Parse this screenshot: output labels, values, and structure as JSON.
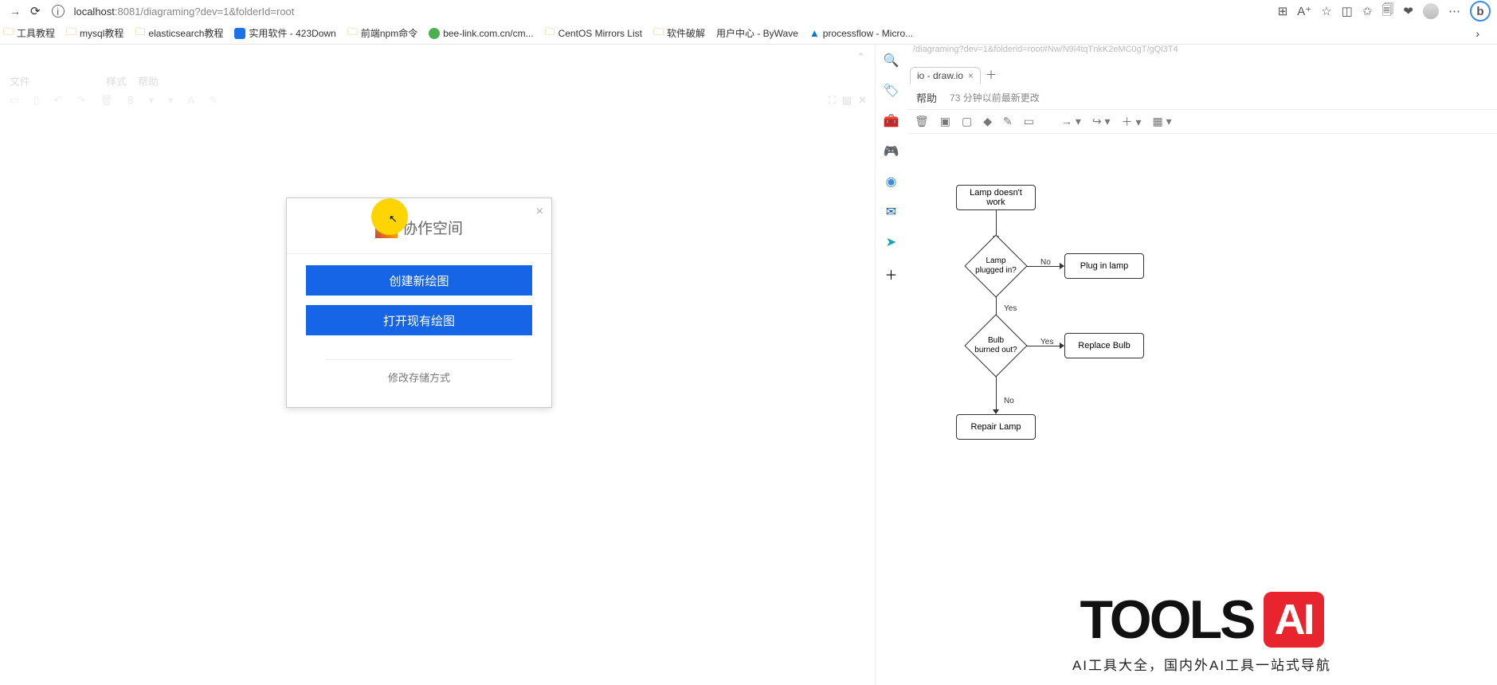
{
  "browser": {
    "url_host": "localhost",
    "url_port_path": ":8081/diagraming?dev=1&folderId=root"
  },
  "bookmarks": [
    {
      "label": "工具教程",
      "icon": "folder"
    },
    {
      "label": "mysql教程",
      "icon": "folder"
    },
    {
      "label": "elasticsearch教程",
      "icon": "folder"
    },
    {
      "label": "实用软件 - 423Down",
      "icon": "blue"
    },
    {
      "label": "前端npm命令",
      "icon": "folder"
    },
    {
      "label": "bee-link.com.cn/cm...",
      "icon": "green"
    },
    {
      "label": "CentOS Mirrors List",
      "icon": "folder"
    },
    {
      "label": "软件破解",
      "icon": "folder"
    },
    {
      "label": "用户中心 - ByWave",
      "icon": ""
    },
    {
      "label": "processflow - Micro...",
      "icon": "azure"
    }
  ],
  "faded_menu": [
    "文件",
    "",
    "",
    "",
    "样式",
    "帮助"
  ],
  "modal": {
    "title": "协作空间",
    "btn_create": "创建新绘图",
    "btn_open": "打开现有绘图",
    "footer": "修改存储方式"
  },
  "right": {
    "addr_fragment": "/diagraming?dev=1&folderid=root#Nw/N9l4tqTnkK2eMC0gT/gQi3T4",
    "tab_label": "io - draw.io",
    "menu_help": "帮助",
    "status": "73 分钟以前最新更改"
  },
  "flowchart": {
    "start": "Lamp doesn't work",
    "d1": "Lamp\nplugged in?",
    "d1_no": "No",
    "d1_yes": "Yes",
    "a1": "Plug in lamp",
    "d2": "Bulb\nburned out?",
    "d2_yes": "Yes",
    "d2_no": "No",
    "a2": "Replace Bulb",
    "end": "Repair Lamp"
  },
  "tools_ai": {
    "title_tools": "TOOLS",
    "title_ai": "AI",
    "sub": "AI工具大全，国内外AI工具一站式导航"
  }
}
